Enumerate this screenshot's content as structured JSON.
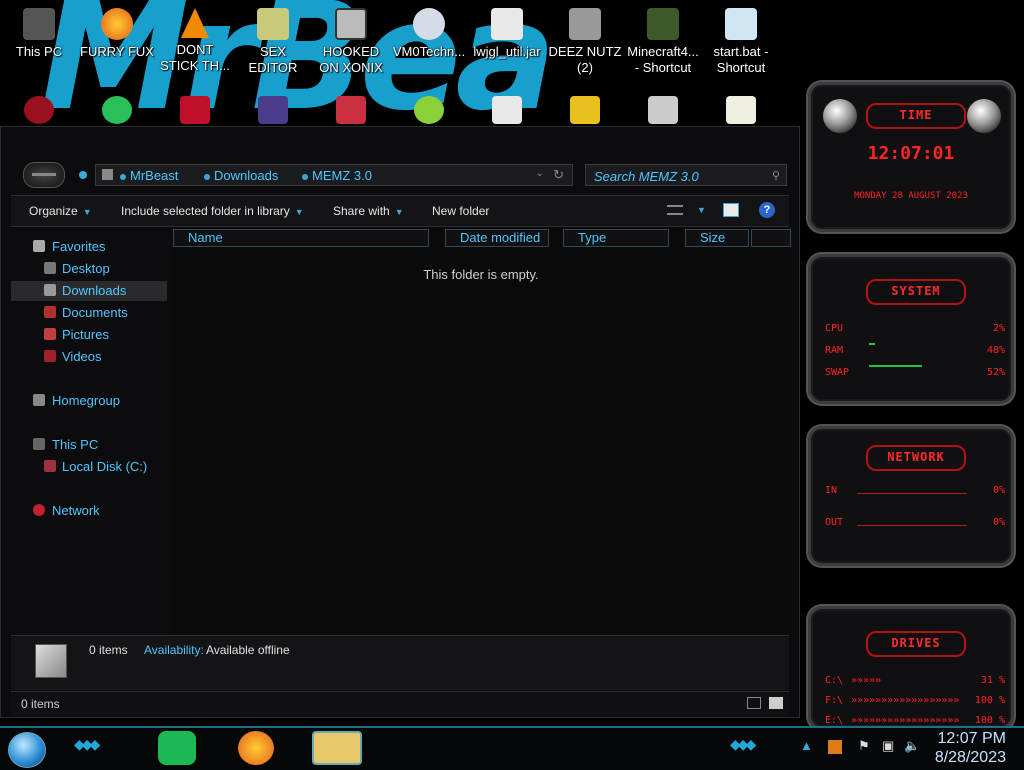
{
  "desktop": {
    "graffiti": "MrBea",
    "icons": [
      {
        "label": "This PC",
        "color": "#777"
      },
      {
        "label": "FURRY FUX",
        "color": "#e07b1a"
      },
      {
        "label": "DONT STICK TH...",
        "color": "#f08a00"
      },
      {
        "label": "SEX EDITOR",
        "color": "#c9c97a"
      },
      {
        "label": "HOOKED ON XONIX",
        "color": "#bbbbbb"
      },
      {
        "label": "VM0Techn...",
        "color": "#d6dbe8"
      },
      {
        "label": "lwjgl_util.jar",
        "color": "#e8e8e8"
      },
      {
        "label": "DEEZ NUTZ (2)",
        "color": "#999999"
      },
      {
        "label": "Minecraft4... - Shortcut",
        "color": "#3d5a2a"
      },
      {
        "label": "start.bat - Shortcut",
        "color": "#cfe7f2"
      }
    ],
    "row2_colors": [
      "#9a1020",
      "#27c05a",
      "#c0102a",
      "#4a3c8a",
      "#8a2a2a",
      "#c83040",
      "#8ad038",
      "#e8e8e8",
      "#e8c020",
      "#cccccc",
      "#f0f0e0"
    ]
  },
  "explorer": {
    "breadcrumb": [
      "MrBeast",
      "Downloads",
      "MEMZ 3.0"
    ],
    "search_placeholder": "Search MEMZ 3.0",
    "toolbar": {
      "organize": "Organize",
      "include": "Include selected folder in library",
      "share": "Share with",
      "new_folder": "New folder"
    },
    "nav": {
      "favorites": "Favorites",
      "desktop": "Desktop",
      "downloads": "Downloads",
      "documents": "Documents",
      "pictures": "Pictures",
      "videos": "Videos",
      "homegroup": "Homegroup",
      "this_pc": "This PC",
      "local_disk": "Local Disk (C:)",
      "network": "Network"
    },
    "columns": [
      "Name",
      "Date modified",
      "Type",
      "Size"
    ],
    "empty_message": "This folder is empty.",
    "details": {
      "count": "0 items",
      "availability_label": "Availability:",
      "availability_value": "Available offline"
    },
    "status": "0 items"
  },
  "gadgets": {
    "time": {
      "title": "TIME",
      "clock": "12:07:01",
      "date": "MONDAY 28 AUGUST 2023"
    },
    "system": {
      "title": "SYSTEM",
      "rows": [
        {
          "label": "CPU",
          "value": "2%",
          "level": 0.02
        },
        {
          "label": "RAM",
          "value": "48%",
          "level": 0.48
        },
        {
          "label": "SWAP",
          "value": "52%",
          "level": 0.52
        }
      ]
    },
    "network": {
      "title": "NETWORK",
      "in_label": "IN",
      "in_value": "0%",
      "out_label": "OUT",
      "out_value": "0%"
    },
    "drives": {
      "title": "DRIVES",
      "rows": [
        {
          "label": "C:\\",
          "value": "31 %"
        },
        {
          "label": "F:\\",
          "value": "100 %"
        },
        {
          "label": "E:\\",
          "value": "100 %"
        }
      ]
    }
  },
  "taskbar": {
    "time": "12:07 PM",
    "date": "8/28/2023"
  }
}
